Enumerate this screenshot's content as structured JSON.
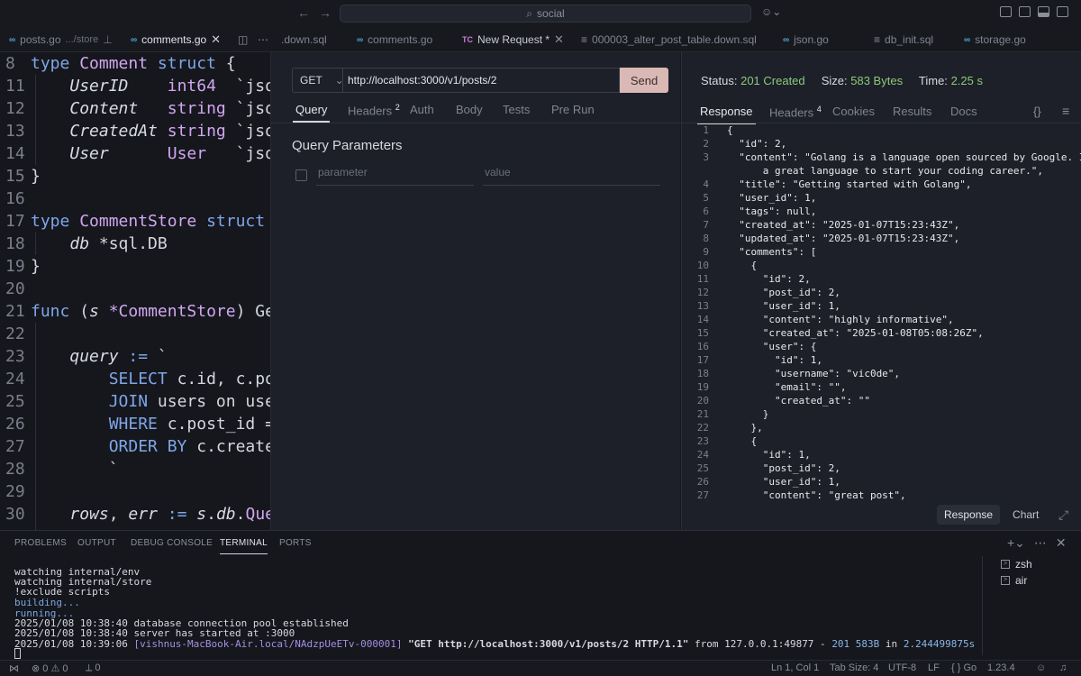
{
  "titlebar": {
    "search_text": "social",
    "back_icon": "arrow-left",
    "forward_icon": "arrow-right"
  },
  "tabs": [
    {
      "label": "posts.go",
      "sub": ".../store",
      "kind": "go"
    },
    {
      "label": "comments.go",
      "kind": "go",
      "active": true
    },
    {
      "label": ".down.sql",
      "kind": "sql"
    },
    {
      "label": "comments.go",
      "kind": "go"
    },
    {
      "label": "New Request *",
      "kind": "tc",
      "badge": "TC"
    },
    {
      "label": "000003_alter_post_table.down.sql",
      "kind": "sql"
    },
    {
      "label": "json.go",
      "kind": "go"
    },
    {
      "label": "db_init.sql",
      "kind": "sql"
    },
    {
      "label": "storage.go",
      "kind": "go"
    }
  ],
  "code": [
    {
      "n": "8",
      "tokens": [
        [
          "kw",
          "type "
        ],
        [
          "ty",
          "Comment "
        ],
        [
          "kw",
          "struct "
        ],
        [
          "cl",
          "{"
        ]
      ]
    },
    {
      "n": "11",
      "tokens": [
        [
          "cl",
          "    "
        ],
        [
          "fld",
          "UserID    "
        ],
        [
          "ty",
          "int64  "
        ],
        [
          "st",
          "`json"
        ]
      ]
    },
    {
      "n": "12",
      "tokens": [
        [
          "cl",
          "    "
        ],
        [
          "fld",
          "Content   "
        ],
        [
          "ty",
          "string "
        ],
        [
          "st",
          "`json"
        ]
      ]
    },
    {
      "n": "13",
      "tokens": [
        [
          "cl",
          "    "
        ],
        [
          "fld",
          "CreatedAt "
        ],
        [
          "ty",
          "string "
        ],
        [
          "st",
          "`json"
        ]
      ]
    },
    {
      "n": "14",
      "tokens": [
        [
          "cl",
          "    "
        ],
        [
          "fld",
          "User      "
        ],
        [
          "ty",
          "User   "
        ],
        [
          "st",
          "`json"
        ]
      ]
    },
    {
      "n": "15",
      "tokens": [
        [
          "cl",
          "}"
        ]
      ]
    },
    {
      "n": "16",
      "tokens": []
    },
    {
      "n": "17",
      "tokens": [
        [
          "kw",
          "type "
        ],
        [
          "ty",
          "CommentStore "
        ],
        [
          "kw",
          "struct "
        ],
        [
          "cl",
          "{"
        ]
      ]
    },
    {
      "n": "18",
      "tokens": [
        [
          "cl",
          "    "
        ],
        [
          "fld",
          "db "
        ],
        [
          "cl",
          "*sql.DB"
        ]
      ]
    },
    {
      "n": "19",
      "tokens": [
        [
          "cl",
          "}"
        ]
      ]
    },
    {
      "n": "20",
      "tokens": []
    },
    {
      "n": "21",
      "tokens": [
        [
          "kw",
          "func "
        ],
        [
          "cl",
          "("
        ],
        [
          "fld",
          "s "
        ],
        [
          "ty",
          "*CommentStore"
        ],
        [
          "cl",
          ") Get"
        ]
      ]
    },
    {
      "n": "22",
      "tokens": []
    },
    {
      "n": "23",
      "tokens": [
        [
          "cl",
          "    "
        ],
        [
          "fld",
          "query "
        ],
        [
          "kw",
          ":= "
        ],
        [
          "st",
          "`"
        ]
      ]
    },
    {
      "n": "24",
      "tokens": [
        [
          "cl",
          "        "
        ],
        [
          "kw",
          "SELECT "
        ],
        [
          "st",
          "c.id, c.pos"
        ]
      ]
    },
    {
      "n": "25",
      "tokens": [
        [
          "cl",
          "        "
        ],
        [
          "kw",
          "JOIN "
        ],
        [
          "st",
          "users on user"
        ]
      ]
    },
    {
      "n": "26",
      "tokens": [
        [
          "cl",
          "        "
        ],
        [
          "kw",
          "WHERE "
        ],
        [
          "st",
          "c.post_id ="
        ]
      ]
    },
    {
      "n": "27",
      "tokens": [
        [
          "cl",
          "        "
        ],
        [
          "kw",
          "ORDER BY "
        ],
        [
          "st",
          "c.created"
        ]
      ]
    },
    {
      "n": "28",
      "tokens": [
        [
          "cl",
          "        "
        ],
        [
          "st",
          "`"
        ]
      ]
    },
    {
      "n": "29",
      "tokens": []
    },
    {
      "n": "30",
      "tokens": [
        [
          "cl",
          "    "
        ],
        [
          "fld",
          "rows"
        ],
        [
          "cl",
          ", "
        ],
        [
          "fld",
          "err "
        ],
        [
          "kw",
          ":= "
        ],
        [
          "fld",
          "s"
        ],
        [
          "cl",
          "."
        ],
        [
          "fld",
          "db"
        ],
        [
          "cl",
          "."
        ],
        [
          "ty",
          "Quer"
        ]
      ]
    }
  ],
  "request": {
    "method": "GET",
    "url": "http://localhost:3000/v1/posts/2",
    "send_label": "Send",
    "tabs": [
      "Query",
      "Headers",
      "Auth",
      "Body",
      "Tests",
      "Pre Run"
    ],
    "headers_count": "2",
    "query_title": "Query Parameters",
    "param_placeholder": "parameter",
    "value_placeholder": "value"
  },
  "response": {
    "status_label": "Status:",
    "status_value": "201 Created",
    "size_label": "Size:",
    "size_value": "583 Bytes",
    "time_label": "Time:",
    "time_value": "2.25 s",
    "tabs": [
      "Response",
      "Headers",
      "Cookies",
      "Results",
      "Docs"
    ],
    "headers_count": "4",
    "braces_icon": "{}",
    "switch_response": "Response",
    "switch_chart": "Chart",
    "json_lines": [
      "{",
      "  \"id\": 2,",
      "  \"content\": \"Golang is a language open sourced by Google. It is",
      "      a great language to start your coding career.\",",
      "  \"title\": \"Getting started with Golang\",",
      "  \"user_id\": 1,",
      "  \"tags\": null,",
      "  \"created_at\": \"2025-01-07T15:23:43Z\",",
      "  \"updated_at\": \"2025-01-07T15:23:43Z\",",
      "  \"comments\": [",
      "    {",
      "      \"id\": 2,",
      "      \"post_id\": 2,",
      "      \"user_id\": 1,",
      "      \"content\": \"highly informative\",",
      "      \"created_at\": \"2025-01-08T05:08:26Z\",",
      "      \"user\": {",
      "        \"id\": 1,",
      "        \"username\": \"vic0de\",",
      "        \"email\": \"\",",
      "        \"created_at\": \"\"",
      "      }",
      "    },",
      "    {",
      "      \"id\": 1,",
      "      \"post_id\": 2,",
      "      \"user_id\": 1,",
      "      \"content\": \"great post\","
    ],
    "json_numbers": [
      "1",
      "2",
      "3",
      "",
      "4",
      "5",
      "6",
      "7",
      "8",
      "9",
      "10",
      "11",
      "12",
      "13",
      "14",
      "15",
      "16",
      "17",
      "18",
      "19",
      "20",
      "21",
      "22",
      "23",
      "24",
      "25",
      "26",
      "27"
    ]
  },
  "panel": {
    "tabs": [
      "PROBLEMS",
      "OUTPUT",
      "DEBUG CONSOLE",
      "TERMINAL",
      "PORTS"
    ],
    "terminals": [
      "zsh",
      "air"
    ],
    "lines": [
      "watching internal/env",
      "watching internal/store",
      "!exclude scripts",
      "building...",
      "running...",
      "2025/01/08 10:38:40 database connection pool established",
      "2025/01/08 10:38:40 server has started at :3000"
    ],
    "log": {
      "prefix": "2025/01/08 10:39:06 ",
      "req_id": "[vishnus-MacBook-Air.local/NAdzpUeETv-000001]",
      "request": " \"GET http://localhost:3000/v1/posts/2 HTTP/1.1\"",
      "from": " from 127.0.0.1:49877 - ",
      "code": "201",
      "size": " 583B",
      "in": " in ",
      "duration": "2.244499875s"
    }
  },
  "statusbar": {
    "errors": "0",
    "warnings": "0",
    "ports": "0",
    "position": "Ln 1, Col 1",
    "tab_size": "Tab Size: 4",
    "encoding": "UTF-8",
    "eol": "LF",
    "language": "Go",
    "version": "1.23.4"
  }
}
